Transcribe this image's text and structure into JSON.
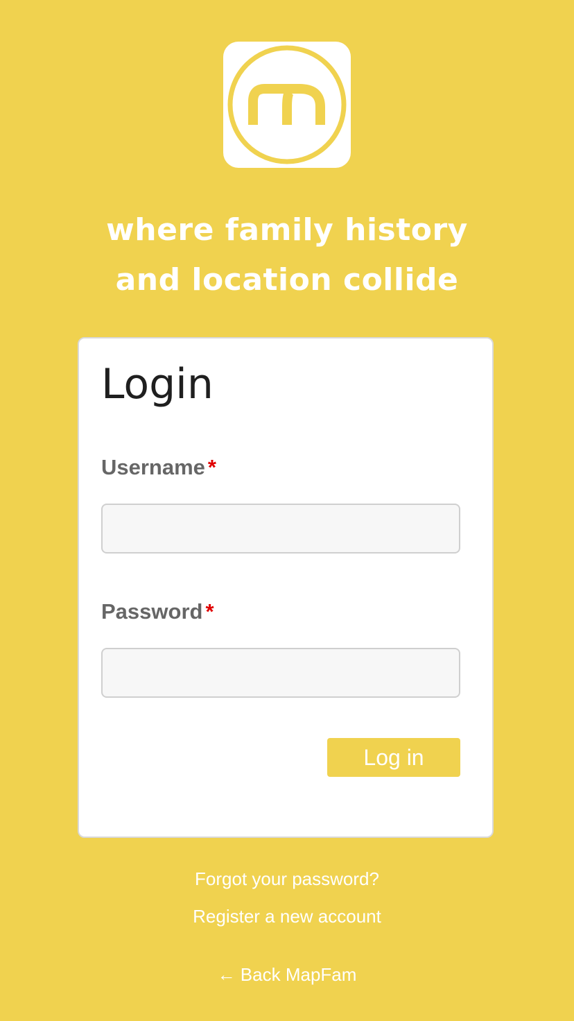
{
  "brand": {
    "logo_alt": "MapFam logo",
    "accent_color": "#f0d24f",
    "tagline_line1": "where family history",
    "tagline_line2": "and location collide"
  },
  "login_card": {
    "title": "Login",
    "username": {
      "label": "Username",
      "required_mark": "*",
      "value": "",
      "placeholder": ""
    },
    "password": {
      "label": "Password",
      "required_mark": "*",
      "value": "",
      "placeholder": ""
    },
    "submit_label": "Log in"
  },
  "links": {
    "forgot_password": "Forgot your password?",
    "register": "Register a new account",
    "back": "← Back MapFam"
  }
}
